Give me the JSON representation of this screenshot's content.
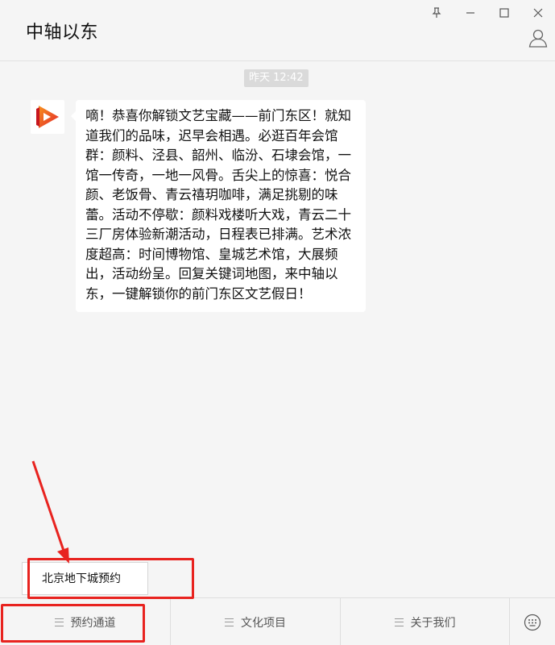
{
  "window": {
    "title": "中轴以东"
  },
  "chat": {
    "timestamp": "昨天 12:42",
    "message": "嘀！恭喜你解锁文艺宝藏——前门东区！就知道我们的品味，迟早会相遇。必逛百年会馆群：颜料、泾县、韶州、临汾、石埭会馆，一馆一传奇，一地一风骨。舌尖上的惊喜：悦合颜、老饭骨、青云禧玥咖啡，满足挑剔的味蕾。活动不停歇：颜料戏楼听大戏，青云二十三厂房体验新潮活动，日程表已排满。艺术浓度超高：时间博物馆、皇城艺术馆，大展频出，活动纷呈。回复关键词地图，来中轴以东，一键解锁你的前门东区文艺假日！"
  },
  "submenu": {
    "item": "北京地下城预约"
  },
  "menu": {
    "items": [
      {
        "label": "预约通道"
      },
      {
        "label": "文化项目"
      },
      {
        "label": "关于我们"
      }
    ]
  },
  "colors": {
    "annotation_red": "#e8231f",
    "logo_orange": "#f26a1b",
    "logo_red": "#e3232c"
  },
  "icons": {
    "pin": "pin-icon",
    "minimize": "minimize-icon",
    "maximize": "maximize-icon",
    "close": "close-icon",
    "user": "user-icon",
    "keyboard": "keyboard-icon",
    "menu": "hamburger-icon"
  }
}
